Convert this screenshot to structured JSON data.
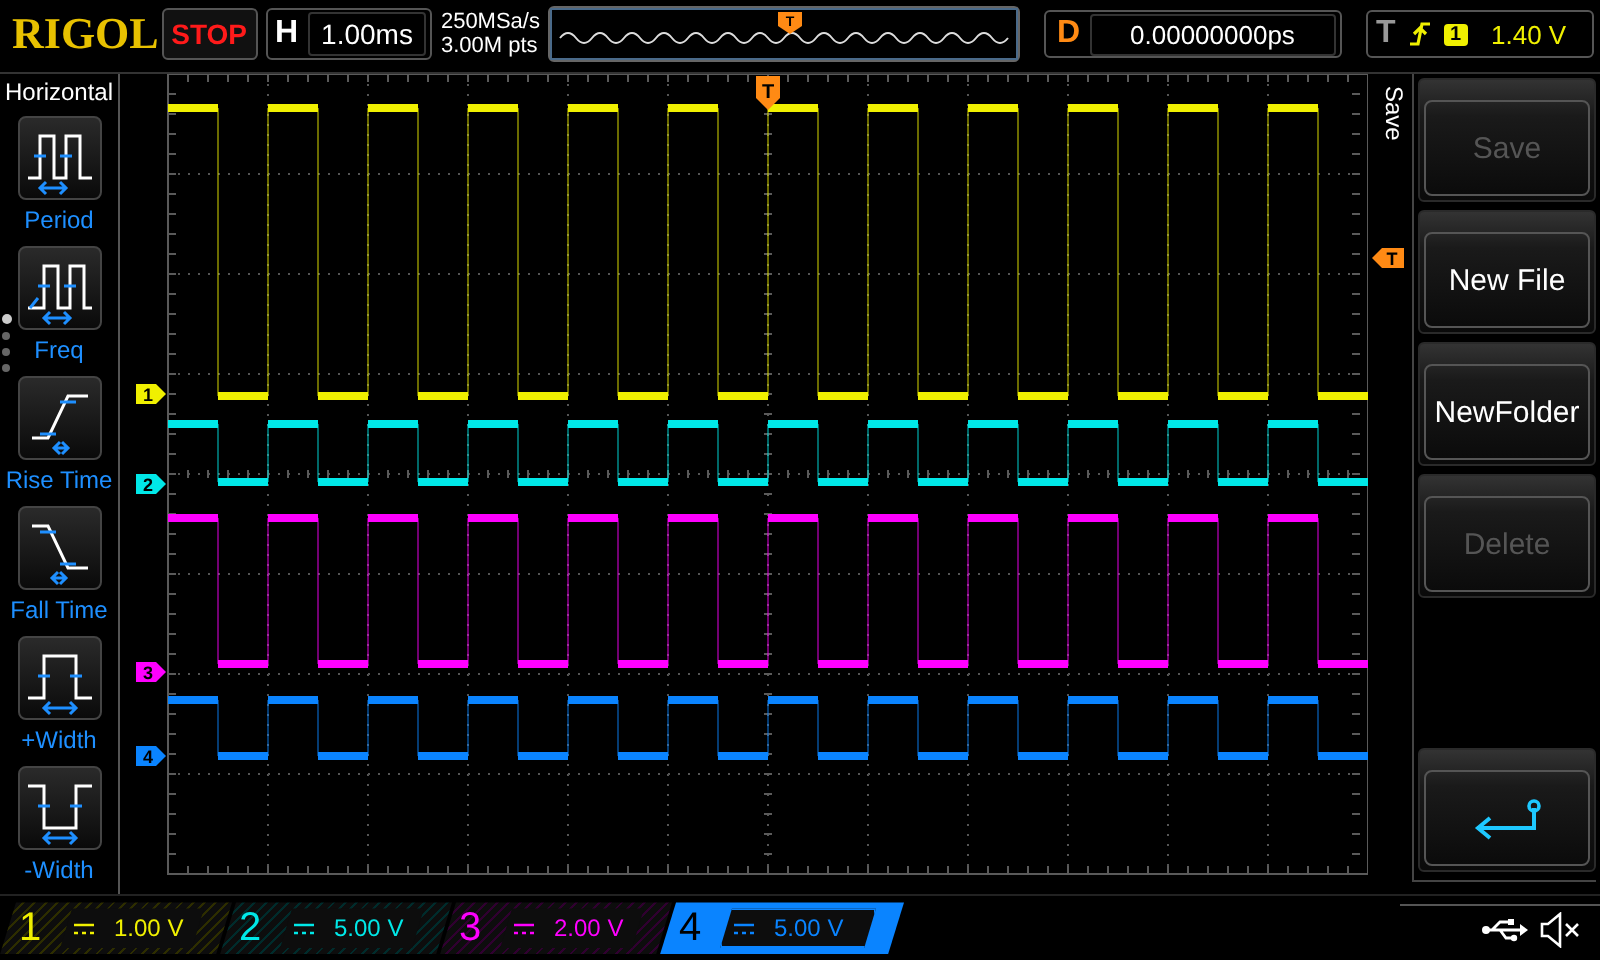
{
  "brand": {
    "logo": "RIGOL"
  },
  "run_state": {
    "label": "STOP"
  },
  "horizontal": {
    "key": "H",
    "timebase": "1.00ms"
  },
  "acquisition": {
    "sample_rate": "250MSa/s",
    "memory_depth": "3.00M pts"
  },
  "delay": {
    "key": "D",
    "value": "0.00000000ps"
  },
  "trigger": {
    "key": "T",
    "source": "1",
    "level": "1.40 V",
    "overview_marker": "T",
    "position_marker": "T",
    "level_marker": "T"
  },
  "left_menu": {
    "title": "Horizontal",
    "items": [
      {
        "label": "Period",
        "kind": "period"
      },
      {
        "label": "Freq",
        "kind": "freq"
      },
      {
        "label": "Rise Time",
        "kind": "rise"
      },
      {
        "label": "Fall Time",
        "kind": "fall"
      },
      {
        "label": "+Width",
        "kind": "pwidth"
      },
      {
        "label": "-Width",
        "kind": "nwidth"
      }
    ],
    "pages": [
      {
        "selected": true
      },
      {
        "selected": false
      },
      {
        "selected": false
      },
      {
        "selected": false
      }
    ]
  },
  "right_menu": {
    "title": "Save",
    "items": [
      {
        "kind": "text",
        "label": "Save",
        "disabled": true
      },
      {
        "kind": "text",
        "label": "New File",
        "disabled": false
      },
      {
        "kind": "text",
        "label": "NewFolder",
        "disabled": false
      },
      {
        "kind": "text",
        "label": "Delete",
        "disabled": true
      },
      {
        "kind": "back"
      }
    ]
  },
  "channels": [
    {
      "number": "1",
      "scale": "1.00 V",
      "color": "#f0f000",
      "selected": false,
      "marker_label": "1"
    },
    {
      "number": "2",
      "scale": "5.00 V",
      "color": "#00e8e8",
      "selected": false,
      "marker_label": "2"
    },
    {
      "number": "3",
      "scale": "2.00 V",
      "color": "#ff00ff",
      "selected": false,
      "marker_label": "3"
    },
    {
      "number": "4",
      "scale": "5.00 V",
      "color": "#0a84ff",
      "selected": true,
      "marker_label": "4"
    }
  ],
  "status": {
    "muted": true
  }
}
